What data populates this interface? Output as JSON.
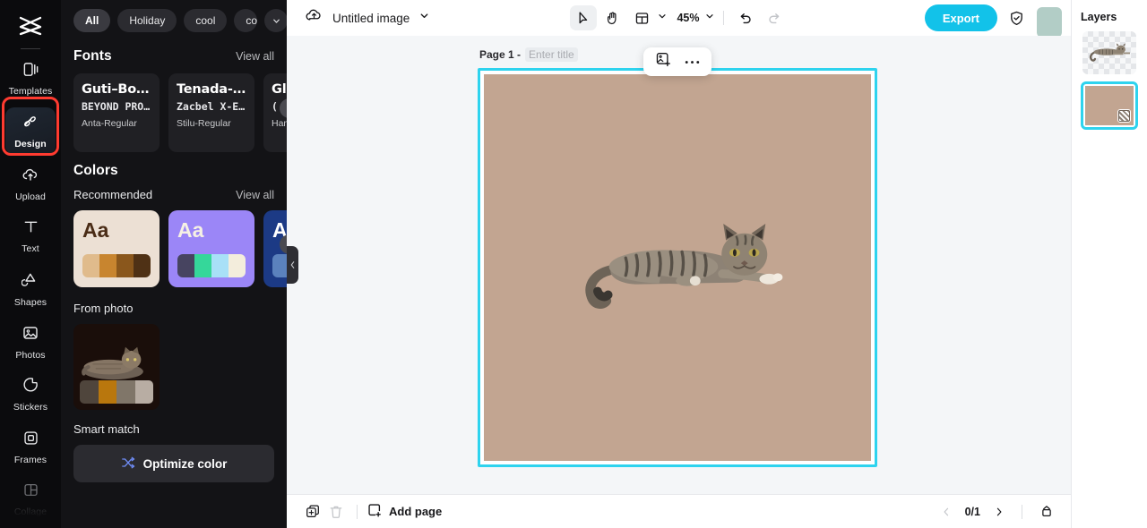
{
  "rail": {
    "logo_icon": "capcut-logo-icon",
    "items": [
      {
        "label": "Templates",
        "icon": "templates-icon",
        "state": "normal"
      },
      {
        "label": "Design",
        "icon": "design-icon",
        "state": "active"
      },
      {
        "label": "Upload",
        "icon": "upload-cloud-icon",
        "state": "normal"
      },
      {
        "label": "Text",
        "icon": "text-icon",
        "state": "normal"
      },
      {
        "label": "Shapes",
        "icon": "shapes-icon",
        "state": "normal"
      },
      {
        "label": "Photos",
        "icon": "photos-icon",
        "state": "normal"
      },
      {
        "label": "Stickers",
        "icon": "stickers-icon",
        "state": "normal"
      },
      {
        "label": "Frames",
        "icon": "frames-icon",
        "state": "normal"
      },
      {
        "label": "Collage",
        "icon": "collage-icon",
        "state": "dim"
      }
    ]
  },
  "panel": {
    "chips": [
      {
        "label": "All",
        "selected": true
      },
      {
        "label": "Holiday",
        "selected": false
      },
      {
        "label": "cool",
        "selected": false
      },
      {
        "label": "concise",
        "selected": false
      }
    ],
    "chips_more_icon": "chevron-down-icon",
    "fonts": {
      "title": "Fonts",
      "view_all": "View all",
      "cards": [
        {
          "line1": "Guti–Bo…",
          "line2": "BEYOND PRO…",
          "line3": "Anta-Regular"
        },
        {
          "line1": "Tenada-…",
          "line2": "Zacbel X-E…",
          "line3": "Stilu-Regular"
        },
        {
          "line1": "Gl",
          "line2": "(",
          "line3": "Ham"
        }
      ]
    },
    "colors": {
      "title": "Colors",
      "recommended_label": "Recommended",
      "view_all": "View all",
      "cards": [
        {
          "sample_text": "Aa",
          "bg": "#ece0d4",
          "text_color": "#4a2c16",
          "swatches": [
            "#e0bb8c",
            "#c8852f",
            "#8a571c",
            "#4f3115"
          ]
        },
        {
          "sample_text": "Aa",
          "bg": "#9b86f7",
          "text_color": "#f6f1e4",
          "swatches": [
            "#474460",
            "#35d79a",
            "#a8e0f7",
            "#f3eddc"
          ]
        },
        {
          "sample_text": "A",
          "bg": "#1c3a85",
          "text_color": "#ffffff",
          "swatches": [
            "#5b82bd"
          ]
        }
      ],
      "next_arrow_icon": "chevron-right-icon"
    },
    "from_photo": {
      "title": "From photo",
      "swatches": [
        "#4f453c",
        "#b9770d",
        "#807669",
        "#b8ada3"
      ],
      "thumb_bg": "#1a0e0a"
    },
    "smart_match": {
      "title": "Smart match",
      "optimize_label": "Optimize color",
      "optimize_icon": "shuffle-icon"
    },
    "collapse_icon": "chevron-left-icon"
  },
  "topbar": {
    "cloud_icon": "cloud-saved-icon",
    "doc_title": "Untitled image",
    "title_caret_icon": "chevron-down-icon",
    "tools": [
      {
        "name": "select",
        "icon": "cursor-arrow-icon",
        "selected": true
      },
      {
        "name": "hand",
        "icon": "hand-icon",
        "selected": false
      },
      {
        "name": "layout",
        "icon": "layout-icon",
        "selected": false
      }
    ],
    "layout_caret_icon": "chevron-down-icon",
    "zoom_value": "45%",
    "zoom_caret_icon": "chevron-down-icon",
    "undo_icon": "undo-icon",
    "redo_icon": "redo-icon",
    "export_label": "Export",
    "shield_icon": "shield-check-icon",
    "avatar": "user-avatar"
  },
  "canvas": {
    "page_label": "Page 1 -",
    "title_placeholder": "Enter title",
    "float_toolbar": [
      {
        "name": "replace-image",
        "icon": "image-add-icon"
      },
      {
        "name": "more-options",
        "icon": "ellipsis-icon"
      }
    ],
    "background_color": "#c2a591",
    "selection_color": "#2ed3ee",
    "artwork_alt": "tabby-cat-lying-down"
  },
  "bottombar": {
    "duplicate_icon": "duplicate-page-icon",
    "delete_icon": "trash-icon",
    "add_page_label": "Add page",
    "add_page_icon": "add-page-icon",
    "prev_icon": "chevron-left-icon",
    "page_count": "0/1",
    "next_icon": "chevron-right-icon",
    "grid_icon": "pages-grid-icon"
  },
  "layers": {
    "title": "Layers",
    "items": [
      {
        "name": "cat-cutout-layer",
        "selected": false,
        "type": "transparent"
      },
      {
        "name": "background-layer",
        "selected": true,
        "type": "fill",
        "color": "#c2a591"
      }
    ]
  }
}
